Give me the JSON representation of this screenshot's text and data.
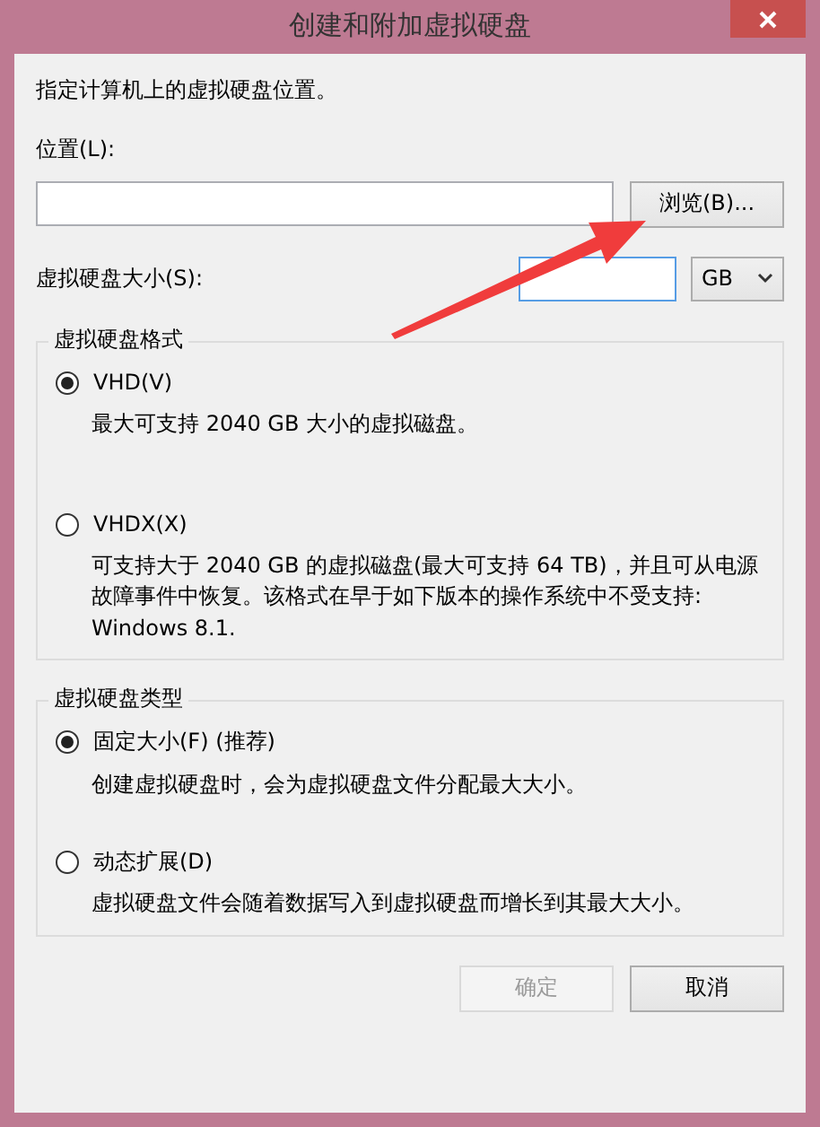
{
  "window": {
    "title": "创建和附加虚拟硬盘"
  },
  "intro": "指定计算机上的虚拟硬盘位置。",
  "location": {
    "label": "位置(L):",
    "browse_button": "浏览(B)..."
  },
  "size": {
    "label": "虚拟硬盘大小(S):",
    "focused": true,
    "unit": "GB"
  },
  "format_group": {
    "title": "虚拟硬盘格式",
    "options": [
      {
        "label": "VHD(V)",
        "selected": true,
        "description": "最大可支持 2040 GB 大小的虚拟磁盘。"
      },
      {
        "label": "VHDX(X)",
        "selected": false,
        "description": "可支持大于 2040 GB 的虚拟磁盘(最大可支持 64 TB)，并且可从电源故障事件中恢复。该格式在早于如下版本的操作系统中不受支持:\nWindows 8.1."
      }
    ]
  },
  "type_group": {
    "title": "虚拟硬盘类型",
    "options": [
      {
        "label": "固定大小(F) (推荐)",
        "selected": true,
        "description": "创建虚拟硬盘时，会为虚拟硬盘文件分配最大大小。"
      },
      {
        "label": "动态扩展(D)",
        "selected": false,
        "description": "虚拟硬盘文件会随着数据写入到虚拟硬盘而增长到其最大大小。"
      }
    ]
  },
  "buttons": [
    {
      "label": "确定",
      "disabled": true
    },
    {
      "label": "取消",
      "disabled": false
    }
  ]
}
